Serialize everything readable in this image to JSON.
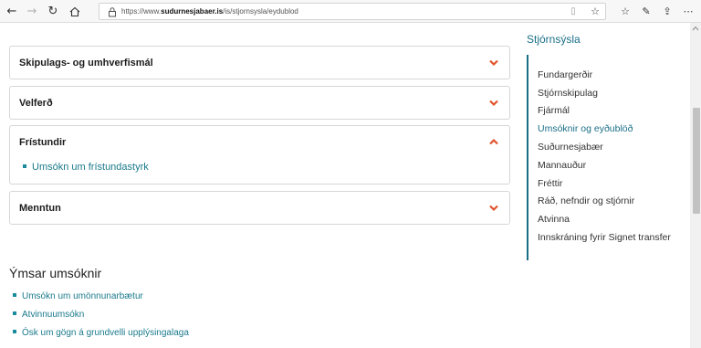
{
  "browser": {
    "url_prefix": "https://www.",
    "url_domain": "sudurnesjabaer.is",
    "url_path": "/is/stjornsysla/eydublod"
  },
  "accordions": [
    {
      "title": "Skipulags- og umhverfismál",
      "expanded": false,
      "links": []
    },
    {
      "title": "Velferð",
      "expanded": false,
      "links": []
    },
    {
      "title": "Frístundir",
      "expanded": true,
      "links": [
        "Umsókn um frístundastyrk"
      ]
    },
    {
      "title": "Menntun",
      "expanded": false,
      "links": []
    }
  ],
  "misc": {
    "title": "Ýmsar umsóknir",
    "items": [
      "Umsókn um umönnunarbætur",
      "Atvinnuumsókn",
      "Ósk um gögn á grundvelli upplýsingalaga"
    ]
  },
  "sidebar": {
    "heading": "Stjórnsýsla",
    "items": [
      {
        "label": "Fundargerðir",
        "active": false
      },
      {
        "label": "Stjórnskipulag",
        "active": false
      },
      {
        "label": "Fjármál",
        "active": false
      },
      {
        "label": "Umsóknir og eyðublöð",
        "active": true
      },
      {
        "label": "Suðurnesjabær",
        "active": false
      },
      {
        "label": "Mannauður",
        "active": false
      },
      {
        "label": "Fréttir",
        "active": false
      },
      {
        "label": "Ráð, nefndir og stjórnir",
        "active": false
      },
      {
        "label": "Atvinna",
        "active": false
      },
      {
        "label": "Innskráning fyrir Signet transfer",
        "active": false
      }
    ]
  },
  "colors": {
    "accent": "#1a6f86",
    "link": "#1a7a8c",
    "chevron": "#e0532b"
  },
  "icons": {
    "back": "back-arrow-icon",
    "forward": "forward-arrow-icon",
    "refresh": "refresh-icon",
    "home": "home-icon",
    "lock": "lock-icon",
    "reader": "reader-view-icon",
    "favorite": "star-icon",
    "favorites_list": "favorites-icon",
    "pen": "pen-icon",
    "share": "share-icon",
    "more": "more-icon",
    "chevron_down": "chevron-down-icon",
    "chevron_up": "chevron-up-icon"
  }
}
